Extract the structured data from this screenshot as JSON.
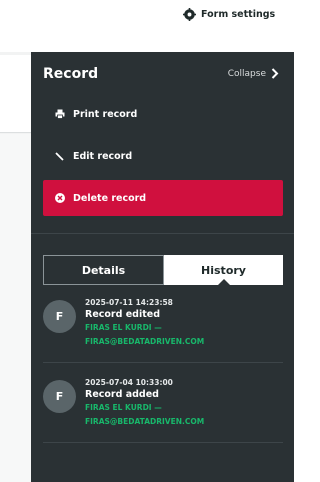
{
  "topbar": {
    "form_settings_label": "Form settings",
    "form_settings_icon": "gear-icon"
  },
  "panel": {
    "title": "Record",
    "collapse_label": "Collapse",
    "collapse_icon": "chevron-right-icon",
    "actions": [
      {
        "label": "Print record",
        "icon": "printer-icon"
      },
      {
        "label": "Edit record",
        "icon": "pencil-icon"
      },
      {
        "label": "Delete record",
        "icon": "close-circle-icon"
      }
    ],
    "delete_color": "#d0103e",
    "tabs": [
      {
        "label": "Details",
        "active": false
      },
      {
        "label": "History",
        "active": true
      }
    ]
  },
  "history": [
    {
      "initial": "F",
      "timestamp": "2025-07-11 14:23:58",
      "title": "Record edited",
      "user_line1": "FIRAS EL KURDI —",
      "user_line2": "FIRAS@BEDATADRIVEN.COM"
    },
    {
      "initial": "F",
      "timestamp": "2025-07-04 10:33:00",
      "title": "Record added",
      "user_line1": "FIRAS EL KURDI —",
      "user_line2": "FIRAS@BEDATADRIVEN.COM"
    }
  ],
  "colors": {
    "panel_bg": "#2a3134",
    "user_link": "#18b86b"
  }
}
